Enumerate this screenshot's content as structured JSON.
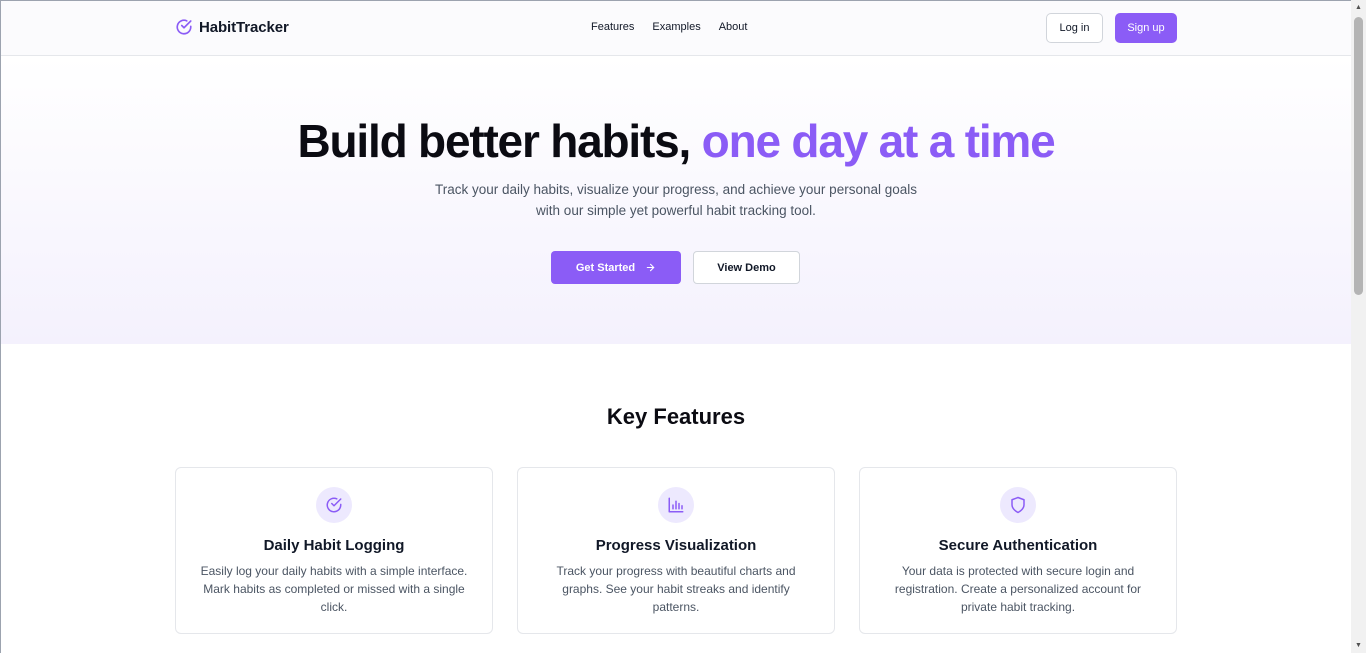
{
  "header": {
    "brand_name": "HabitTracker",
    "brand_icon": "check-circle-icon",
    "nav": [
      {
        "label": "Features"
      },
      {
        "label": "Examples"
      },
      {
        "label": "About"
      }
    ],
    "login_label": "Log in",
    "signup_label": "Sign up"
  },
  "hero": {
    "title_main": "Build better habits,",
    "title_accent": "one day at a time",
    "subtitle": "Track your daily habits, visualize your progress, and achieve your personal goals with our simple yet powerful habit tracking tool.",
    "primary_label": "Get Started",
    "primary_icon": "arrow-right-icon",
    "secondary_label": "View Demo"
  },
  "features": {
    "title": "Key Features",
    "cards": [
      {
        "icon": "check-circle-icon",
        "title": "Daily Habit Logging",
        "description": "Easily log your daily habits with a simple interface. Mark habits as completed or missed with a single click."
      },
      {
        "icon": "bar-chart-icon",
        "title": "Progress Visualization",
        "description": "Track your progress with beautiful charts and graphs. See your habit streaks and identify patterns."
      },
      {
        "icon": "shield-icon",
        "title": "Secure Authentication",
        "description": "Your data is protected with secure login and registration. Create a personalized account for private habit tracking."
      }
    ]
  },
  "colors": {
    "accent": "#8b5cf6",
    "accent_light": "#ede9fe",
    "text": "#111827",
    "muted": "#4b5563"
  }
}
